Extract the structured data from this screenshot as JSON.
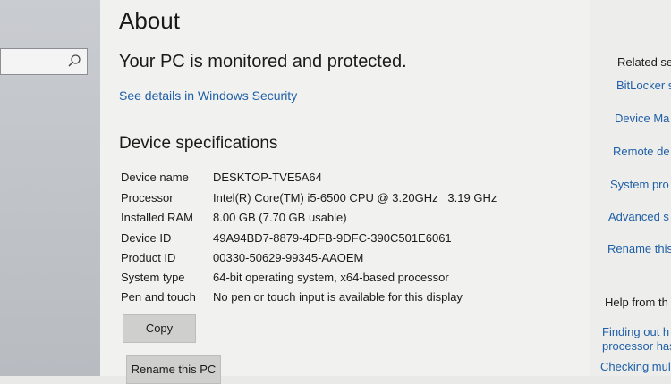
{
  "search": {
    "icon": "search-icon"
  },
  "main": {
    "title": "About",
    "status": "Your PC is monitored and protected.",
    "security_link": "See details in Windows Security",
    "section_title": "Device specifications",
    "specs": [
      {
        "label": "Device name",
        "value": "DESKTOP-TVE5A64"
      },
      {
        "label": "Processor",
        "value": "Intel(R) Core(TM) i5-6500 CPU @ 3.20GHz   3.19 GHz"
      },
      {
        "label": "Installed RAM",
        "value": "8.00 GB (7.70 GB usable)"
      },
      {
        "label": "Device ID",
        "value": "49A94BD7-8879-4DFB-9DFC-390C501E6061"
      },
      {
        "label": "Product ID",
        "value": "00330-50629-99345-AAOEM"
      },
      {
        "label": "System type",
        "value": "64-bit operating system, x64-based processor"
      },
      {
        "label": "Pen and touch",
        "value": "No pen or touch input is available for this display"
      }
    ],
    "copy_label": "Copy",
    "rename_label": "Rename this PC"
  },
  "right_panel": {
    "related_heading": "Related se",
    "links": [
      "BitLocker s",
      "Device Ma",
      "Remote de",
      "System pro",
      "Advanced s",
      "Rename this"
    ],
    "help_heading": "Help from th",
    "help_links": [
      "Finding out h",
      "processor has",
      "Checking mul"
    ]
  },
  "colors": {
    "link": "#1f5fa8",
    "background": "#f1f1ef"
  }
}
